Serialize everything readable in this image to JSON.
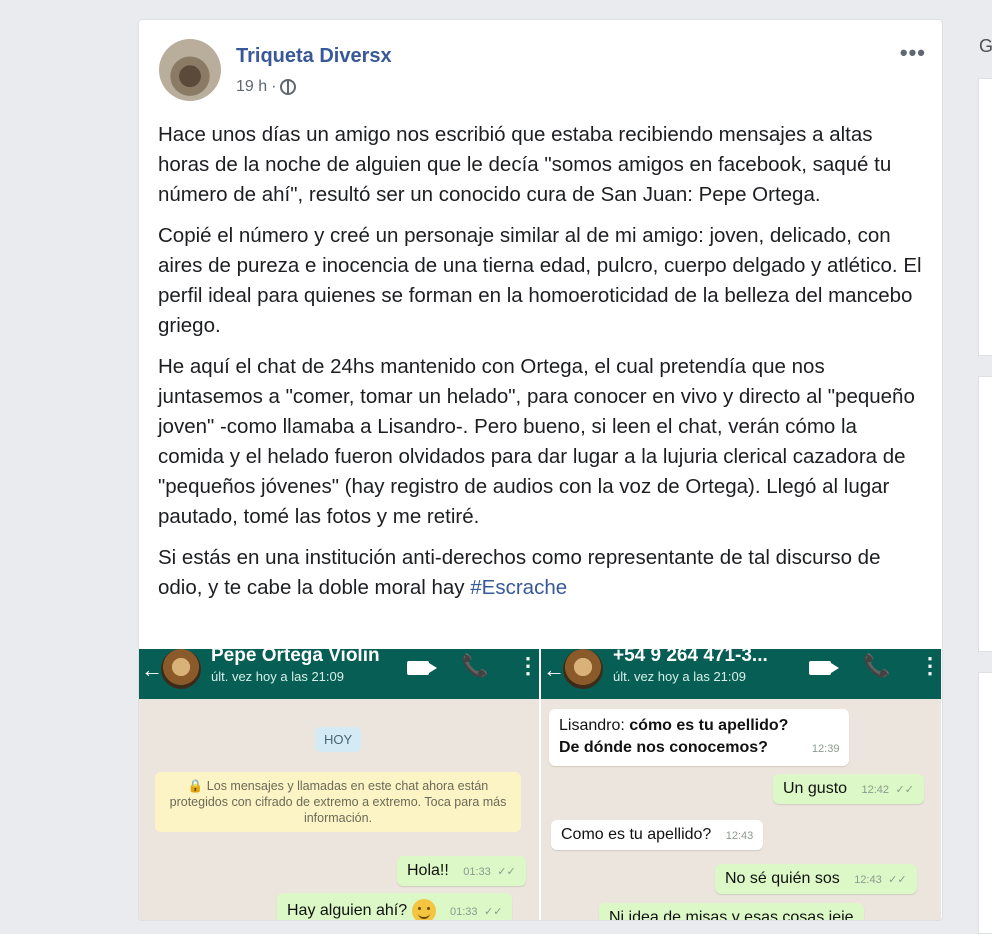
{
  "post": {
    "page_name": "Triqueta Diversx",
    "time": "19 h",
    "separator": "·",
    "more_menu": "•••",
    "paragraphs": [
      "Hace unos días un amigo nos escribió que estaba recibiendo mensajes a altas horas de la noche de alguien que le decía \"somos amigos en facebook, saqué tu número de ahí\", resultó ser un conocido cura de San Juan: Pepe Ortega.",
      "Copié el número y creé un personaje similar al de mi amigo: joven, delicado, con aires de pureza e inocencia de una tierna edad, pulcro, cuerpo delgado y atlético. El perfil ideal para quienes se forman en la homoeroticidad de la belleza del mancebo griego.",
      "He aquí el chat de 24hs mantenido con Ortega, el cual pretendía que nos juntasemos a \"comer, tomar un helado\", para conocer en vivo y directo al \"pequeño joven\" -como llamaba a Lisandro-. Pero bueno, si leen el chat, verán cómo la comida y el helado fueron olvidados para dar lugar a la lujuria clerical cazadora de \"pequeños jóvenes\" (hay registro de audios con la voz de Ortega). Llegó al lugar pautado, tomé las fotos y me retiré."
    ],
    "last_paragraph": "Si estás en una institución anti-derechos como representante de tal discurso de odio, y te cabe la doble moral hay",
    "hashtag": "#Escrache"
  },
  "chat_left": {
    "back": "←",
    "contact_name": "Pepe Ortega Violin",
    "status": "últ. vez hoy a las 21:09",
    "day_label": "HOY",
    "encryption_notice": "🔒 Los mensajes y llamadas en este chat ahora están protegidos con cifrado de extremo a extremo. Toca para más información.",
    "messages": [
      {
        "text": "Hola!!",
        "time": "01:33",
        "ticks": "✓✓"
      },
      {
        "text": "Hay alguien ahí?",
        "time": "01:33",
        "ticks": "✓✓"
      }
    ]
  },
  "chat_right": {
    "back": "←",
    "contact_name": "+54 9 264 471-3...",
    "status": "últ. vez hoy a las 21:09",
    "quoted_prefix": "Lisandro: ",
    "quoted_line1": "cómo es tu apellido?",
    "quoted_line2": "De dónde nos conocemos?",
    "quoted_time": "12:39",
    "messages": [
      {
        "text": "Un gusto",
        "time": "12:42",
        "ticks": "✓✓"
      },
      {
        "text": "Como es tu apellido?",
        "time": "12:43"
      },
      {
        "text": "No sé quién sos",
        "time": "12:43",
        "ticks": "✓✓"
      },
      {
        "text": "Ni idea de misas y esas cosas jeje"
      }
    ]
  },
  "sidebar": {
    "header_letter": "G"
  },
  "icons": {
    "phone": "📞",
    "dots": "⋮"
  },
  "colors": {
    "facebook_link": "#385898",
    "whatsapp_bar": "#075e54",
    "outgoing_bubble": "#dcf8c6"
  }
}
